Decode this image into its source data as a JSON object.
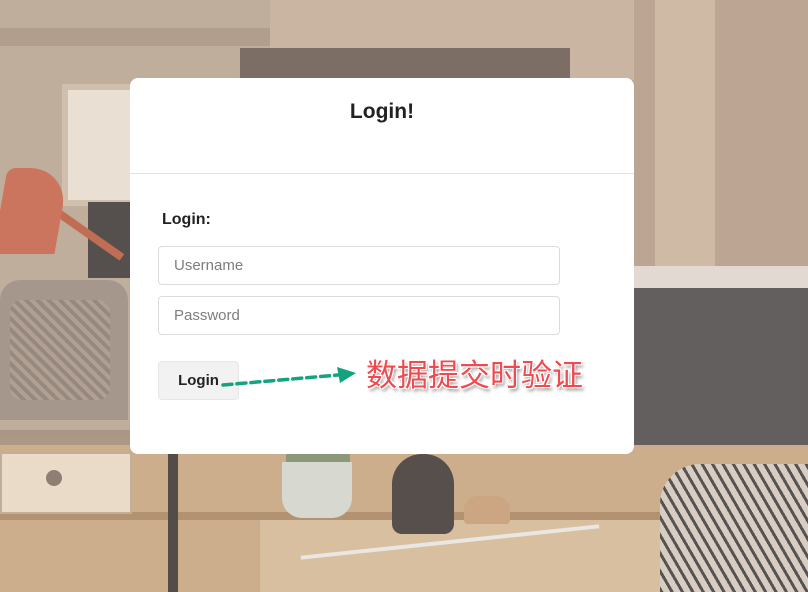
{
  "card": {
    "title": "Login!",
    "form_label": "Login:"
  },
  "fields": {
    "username": {
      "placeholder": "Username",
      "value": ""
    },
    "password": {
      "placeholder": "Password",
      "value": ""
    }
  },
  "actions": {
    "login_label": "Login"
  },
  "annotation": {
    "text": "数据提交时验证",
    "text_color": "#ef4a4f",
    "arrow_color": "#14a37f"
  },
  "colors": {
    "card_background": "#ffffff",
    "button_background": "#f2f2f2"
  }
}
